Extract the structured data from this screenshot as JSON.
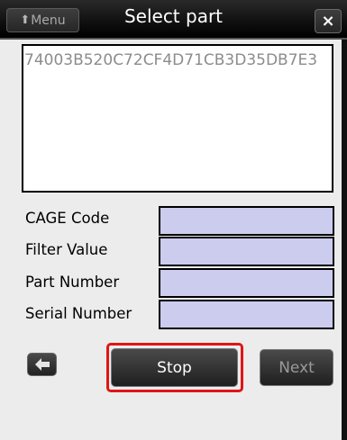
{
  "header": {
    "menu_label": "Menu",
    "title": "Select part",
    "close_label": "×"
  },
  "part_text": "74003B520C72CF4D71CB3D35DB7E3",
  "fields": [
    {
      "label": "CAGE Code",
      "value": ""
    },
    {
      "label": "Filter Value",
      "value": ""
    },
    {
      "label": "Part Number",
      "value": ""
    },
    {
      "label": "Serial Number",
      "value": ""
    }
  ],
  "buttons": {
    "back_icon": "back-arrow-icon",
    "stop_label": "Stop",
    "next_label": "Next"
  },
  "colors": {
    "field_background": "#ccccee",
    "highlight_border": "#e01515",
    "titlebar": "#111111"
  }
}
